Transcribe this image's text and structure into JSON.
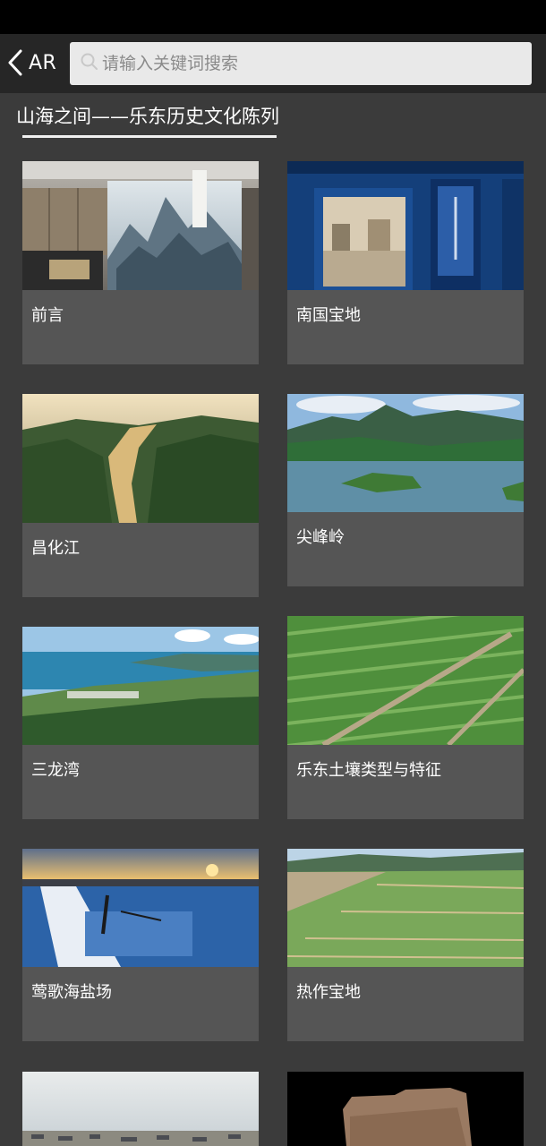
{
  "header": {
    "back_label": "AR",
    "search_placeholder": "请输入关键词搜索"
  },
  "section": {
    "title": "山海之间——乐东历史文化陈列"
  },
  "cards": [
    {
      "label": "前言",
      "scene": "museum-lobby-mural"
    },
    {
      "label": "南国宝地",
      "scene": "exhibition-hall-banner"
    },
    {
      "label": "昌化江",
      "scene": "river-valley-sunset"
    },
    {
      "label": "尖峰岭",
      "scene": "mountain-lake"
    },
    {
      "label": "三龙湾",
      "scene": "coastal-bay"
    },
    {
      "label": "乐东土壤类型与特征",
      "scene": "green-farm-rows"
    },
    {
      "label": "莺歌海盐场",
      "scene": "salt-pans-sunset"
    },
    {
      "label": "热作宝地",
      "scene": "crop-fields"
    },
    {
      "label": "",
      "scene": "beach-boats"
    },
    {
      "label": "",
      "scene": "stone-artifact"
    }
  ]
}
